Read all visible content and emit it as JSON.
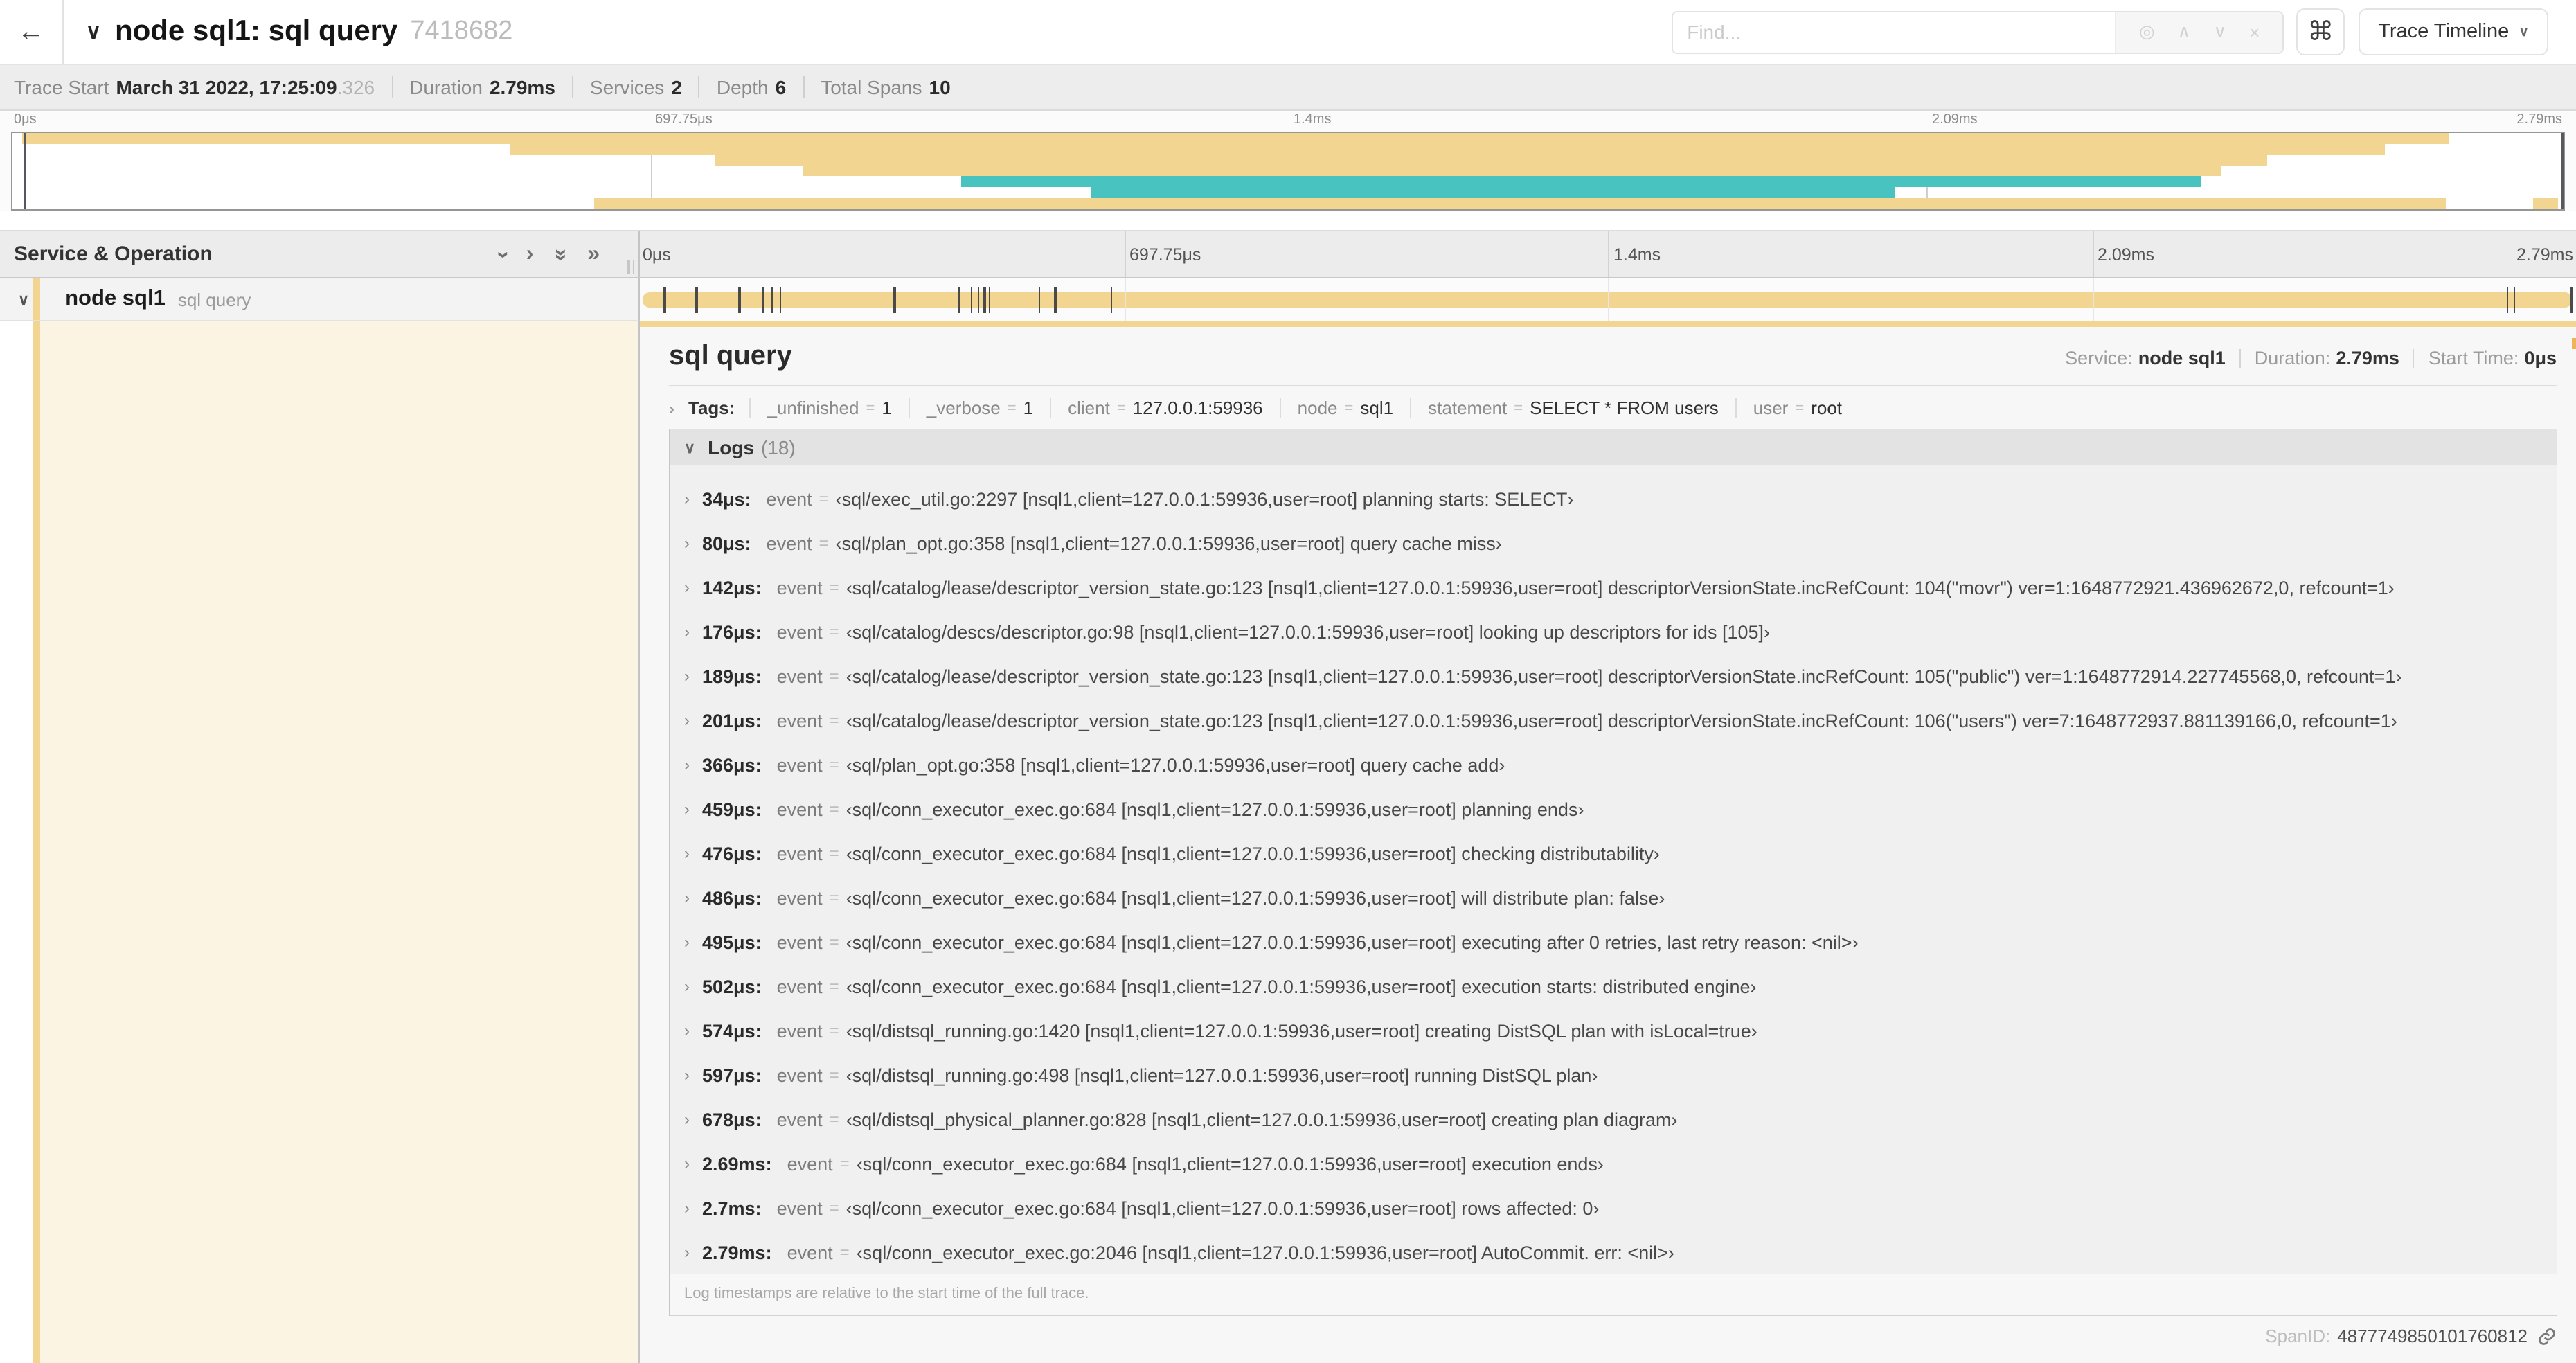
{
  "header": {
    "back_icon": "←",
    "collapse_icon": "∨",
    "title": "node sql1: sql query",
    "trace_id": "7418682",
    "find_placeholder": "Find...",
    "find_icons": {
      "locate": "◎",
      "prev": "∧",
      "next": "∨",
      "clear": "×"
    },
    "shortcut_icon": "⌘",
    "view_selector": "Trace Timeline",
    "view_caret": "∨"
  },
  "summary": {
    "items": [
      {
        "label": "Trace Start",
        "value": "March 31 2022, 17:25:09",
        "muted_suffix": ".326"
      },
      {
        "label": "Duration",
        "value": "2.79ms",
        "muted_suffix": ""
      },
      {
        "label": "Services",
        "value": "2",
        "muted_suffix": ""
      },
      {
        "label": "Depth",
        "value": "6",
        "muted_suffix": ""
      },
      {
        "label": "Total Spans",
        "value": "10",
        "muted_suffix": ""
      }
    ]
  },
  "timeline": {
    "tick_labels": [
      "0μs",
      "697.75μs",
      "1.4ms",
      "2.09ms",
      "2.79ms"
    ],
    "tick_fractions": [
      0,
      0.25,
      0.5,
      0.75,
      1
    ],
    "total_us": 2790,
    "event_times_us": [
      34,
      80,
      142,
      176,
      189,
      201,
      366,
      459,
      476,
      486,
      495,
      502,
      574,
      597,
      678,
      2690,
      2700,
      2790
    ]
  },
  "colors": {
    "tan": "#f2d591",
    "teal": "#49c3bf",
    "cream": "#fcf4e2"
  },
  "minimap": {
    "bars": [
      {
        "row": 0,
        "start": 0.4,
        "end": 95.5,
        "color": "tan"
      },
      {
        "row": 1,
        "start": 19.5,
        "end": 93.0,
        "color": "tan"
      },
      {
        "row": 2,
        "start": 27.5,
        "end": 88.4,
        "color": "tan"
      },
      {
        "row": 3,
        "start": 31.0,
        "end": 86.6,
        "color": "tan"
      },
      {
        "row": 4,
        "start": 37.2,
        "end": 85.8,
        "color": "teal"
      },
      {
        "row": 5,
        "start": 42.3,
        "end": 73.8,
        "color": "teal"
      },
      {
        "row": 6,
        "start": 22.8,
        "end": 95.4,
        "color": "tan"
      },
      {
        "row": 6,
        "start": 98.8,
        "end": 99.8,
        "color": "tan"
      }
    ]
  },
  "span_table": {
    "header_label": "Service & Operation",
    "icons": {
      "collapse_one": "›",
      "expand_one": "›",
      "collapse_all": "»",
      "expand_all": "»"
    }
  },
  "span_row": {
    "chevron": "∨",
    "service": "node sql1",
    "operation": "sql query"
  },
  "detail": {
    "title": "sql query",
    "service_label": "Service:",
    "service": "node sql1",
    "duration_label": "Duration:",
    "duration": "2.79ms",
    "start_time_label": "Start Time:",
    "start_time": "0μs",
    "tags": {
      "chevron": "›",
      "label": "Tags:",
      "items": [
        {
          "key": "_unfinished",
          "value": "1"
        },
        {
          "key": "_verbose",
          "value": "1"
        },
        {
          "key": "client",
          "value": "127.0.0.1:59936"
        },
        {
          "key": "node",
          "value": "sql1"
        },
        {
          "key": "statement",
          "value": "SELECT * FROM users"
        },
        {
          "key": "user",
          "value": "root"
        }
      ]
    },
    "logs": {
      "chevron": "∨",
      "label": "Logs",
      "count": "(18)",
      "entry_chevron": "›",
      "field": "event",
      "entries": [
        {
          "time": "34μs:",
          "value": "‹sql/exec_util.go:2297 [nsql1,client=127.0.0.1:59936,user=root] planning starts: SELECT›"
        },
        {
          "time": "80μs:",
          "value": "‹sql/plan_opt.go:358 [nsql1,client=127.0.0.1:59936,user=root] query cache miss›"
        },
        {
          "time": "142μs:",
          "value": "‹sql/catalog/lease/descriptor_version_state.go:123 [nsql1,client=127.0.0.1:59936,user=root] descriptorVersionState.incRefCount: 104(\"movr\") ver=1:1648772921.436962672,0, refcount=1›"
        },
        {
          "time": "176μs:",
          "value": "‹sql/catalog/descs/descriptor.go:98 [nsql1,client=127.0.0.1:59936,user=root] looking up descriptors for ids [105]›"
        },
        {
          "time": "189μs:",
          "value": "‹sql/catalog/lease/descriptor_version_state.go:123 [nsql1,client=127.0.0.1:59936,user=root] descriptorVersionState.incRefCount: 105(\"public\") ver=1:1648772914.227745568,0, refcount=1›"
        },
        {
          "time": "201μs:",
          "value": "‹sql/catalog/lease/descriptor_version_state.go:123 [nsql1,client=127.0.0.1:59936,user=root] descriptorVersionState.incRefCount: 106(\"users\") ver=7:1648772937.881139166,0, refcount=1›"
        },
        {
          "time": "366μs:",
          "value": "‹sql/plan_opt.go:358 [nsql1,client=127.0.0.1:59936,user=root] query cache add›"
        },
        {
          "time": "459μs:",
          "value": "‹sql/conn_executor_exec.go:684 [nsql1,client=127.0.0.1:59936,user=root] planning ends›"
        },
        {
          "time": "476μs:",
          "value": "‹sql/conn_executor_exec.go:684 [nsql1,client=127.0.0.1:59936,user=root] checking distributability›"
        },
        {
          "time": "486μs:",
          "value": "‹sql/conn_executor_exec.go:684 [nsql1,client=127.0.0.1:59936,user=root] will distribute plan: false›"
        },
        {
          "time": "495μs:",
          "value": "‹sql/conn_executor_exec.go:684 [nsql1,client=127.0.0.1:59936,user=root] executing after 0 retries, last retry reason: <nil>›"
        },
        {
          "time": "502μs:",
          "value": "‹sql/conn_executor_exec.go:684 [nsql1,client=127.0.0.1:59936,user=root] execution starts: distributed engine›"
        },
        {
          "time": "574μs:",
          "value": "‹sql/distsql_running.go:1420 [nsql1,client=127.0.0.1:59936,user=root] creating DistSQL plan with isLocal=true›"
        },
        {
          "time": "597μs:",
          "value": "‹sql/distsql_running.go:498 [nsql1,client=127.0.0.1:59936,user=root] running DistSQL plan›"
        },
        {
          "time": "678μs:",
          "value": "‹sql/distsql_physical_planner.go:828 [nsql1,client=127.0.0.1:59936,user=root] creating plan diagram›"
        },
        {
          "time": "2.69ms:",
          "value": "‹sql/conn_executor_exec.go:684 [nsql1,client=127.0.0.1:59936,user=root] execution ends›"
        },
        {
          "time": "2.7ms:",
          "value": "‹sql/conn_executor_exec.go:684 [nsql1,client=127.0.0.1:59936,user=root] rows affected: 0›"
        },
        {
          "time": "2.79ms:",
          "value": "‹sql/conn_executor_exec.go:2046 [nsql1,client=127.0.0.1:59936,user=root] AutoCommit. err: <nil>›"
        }
      ],
      "footer": "Log timestamps are relative to the start time of the full trace."
    },
    "span_id_label": "SpanID:",
    "span_id": "4877749850101760812"
  }
}
